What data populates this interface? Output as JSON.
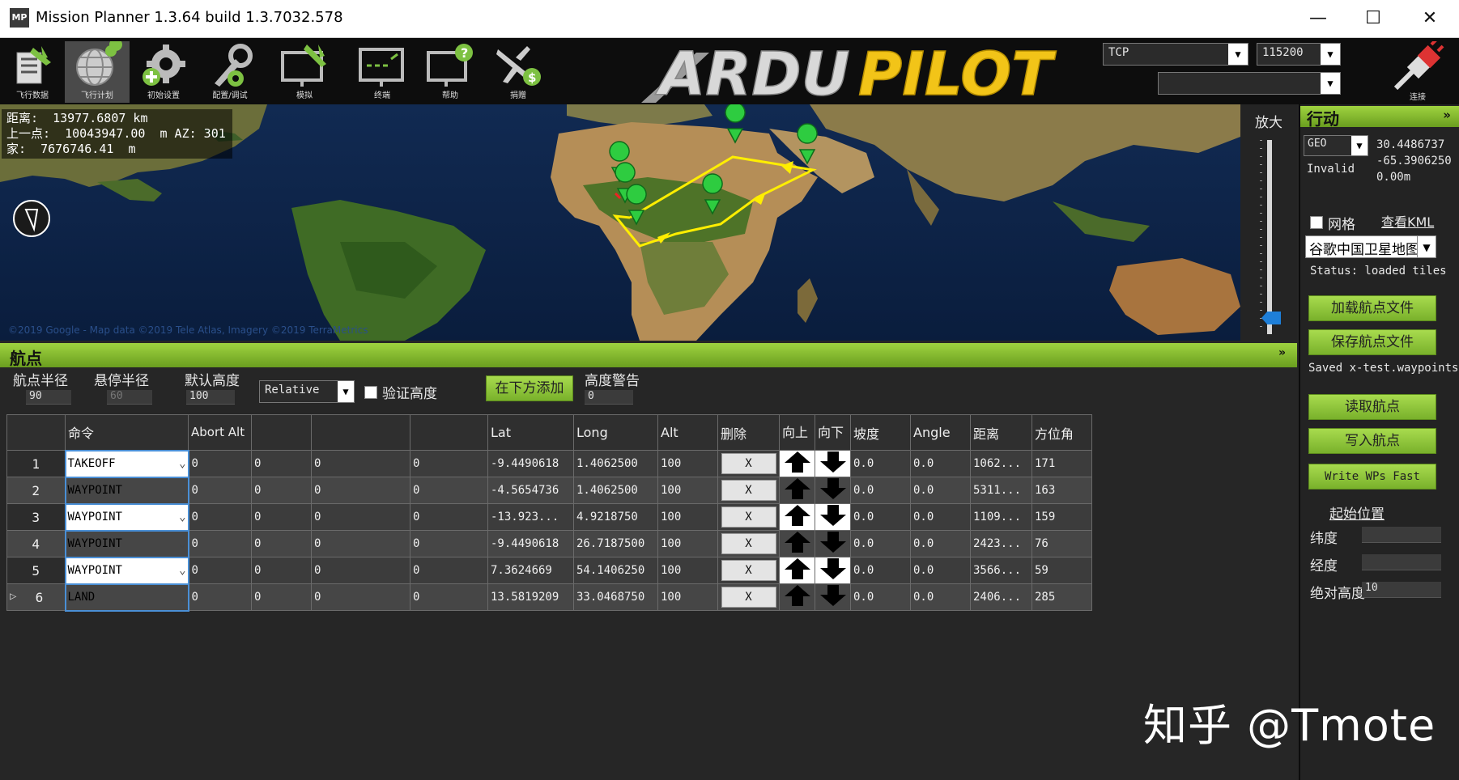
{
  "window": {
    "title": "Mission Planner 1.3.64 build 1.3.7032.578",
    "icon_text": "MP",
    "minimize": "—",
    "maximize": "☐",
    "close": "✕"
  },
  "toolbar": {
    "items": [
      {
        "label": "飞行数据",
        "icon": "flight-data-icon"
      },
      {
        "label": "飞行计划",
        "icon": "flight-plan-icon"
      },
      {
        "label": "初始设置",
        "icon": "initial-setup-icon"
      },
      {
        "label": "配置/调试",
        "icon": "config-tuning-icon"
      },
      {
        "label": "模拟",
        "icon": "simulation-icon"
      },
      {
        "label": "终端",
        "icon": "terminal-icon"
      },
      {
        "label": "帮助",
        "icon": "help-icon"
      },
      {
        "label": "捐赠",
        "icon": "donate-icon"
      }
    ],
    "logo_text_1": "ARDU",
    "logo_text_2": "PILOT",
    "connection_type": "TCP",
    "baud_rate": "115200",
    "port": "",
    "connect_label": "连接"
  },
  "map": {
    "info": {
      "distance": "距离:  13977.6807 km",
      "prev_point": "上一点:  10043947.00  m AZ: 301",
      "home": "家:  7676746.41  m"
    },
    "copyright": "©2019 Google - Map data ©2019 Tele Atlas, Imagery ©2019 TerraMetrics",
    "zoom_label": "放大"
  },
  "action_panel": {
    "title": "行动",
    "coord_system": "GEO",
    "lat": "30.4486737",
    "lng": "-65.3906250",
    "alt": "0.00m",
    "status_invalid": "Invalid",
    "grid_label": "网格",
    "view_kml": "查看KML",
    "map_provider": "谷歌中国卫星地图",
    "status": "Status: loaded tiles",
    "load_wp_file": "加载航点文件",
    "save_wp_file": "保存航点文件",
    "saved_msg": "Saved x-test.waypoints",
    "read_wp": "读取航点",
    "write_wp": "写入航点",
    "write_fast": "Write WPs Fast",
    "home_title": "起始位置",
    "home_lat_label": "纬度",
    "home_lng_label": "经度",
    "home_alt_label": "绝对高度",
    "home_lat": "",
    "home_lng": "",
    "home_alt": "10"
  },
  "waypoints": {
    "title": "航点",
    "wp_radius_label": "航点半径",
    "wp_radius": "90",
    "loiter_radius_label": "悬停半径",
    "loiter_radius": "60",
    "default_alt_label": "默认高度",
    "default_alt": "100",
    "alt_frame": "Relative",
    "verify_height": "验证高度",
    "add_below": "在下方添加",
    "alt_warn_label": "高度警告",
    "alt_warn": "0",
    "columns": [
      "",
      "命令",
      "Abort Alt",
      "",
      "",
      "",
      "Lat",
      "Long",
      "Alt",
      "删除",
      "向上",
      "向下",
      "坡度",
      "Angle",
      "距离",
      "方位角"
    ],
    "rows": [
      {
        "n": "1",
        "cmd": "TAKEOFF",
        "p1": "0",
        "p2": "0",
        "p3": "0",
        "p4": "0",
        "lat": "-9.4490618",
        "lng": "1.4062500",
        "alt": "100",
        "del": "X",
        "grad": "0.0",
        "angle": "0.0",
        "dist": "1062...",
        "az": "171",
        "current": ""
      },
      {
        "n": "2",
        "cmd": "WAYPOINT",
        "p1": "0",
        "p2": "0",
        "p3": "0",
        "p4": "0",
        "lat": "-4.5654736",
        "lng": "1.4062500",
        "alt": "100",
        "del": "X",
        "grad": "0.0",
        "angle": "0.0",
        "dist": "5311...",
        "az": "163",
        "current": ""
      },
      {
        "n": "3",
        "cmd": "WAYPOINT",
        "p1": "0",
        "p2": "0",
        "p3": "0",
        "p4": "0",
        "lat": "-13.923...",
        "lng": "4.9218750",
        "alt": "100",
        "del": "X",
        "grad": "0.0",
        "angle": "0.0",
        "dist": "1109...",
        "az": "159",
        "current": ""
      },
      {
        "n": "4",
        "cmd": "WAYPOINT",
        "p1": "0",
        "p2": "0",
        "p3": "0",
        "p4": "0",
        "lat": "-9.4490618",
        "lng": "26.7187500",
        "alt": "100",
        "del": "X",
        "grad": "0.0",
        "angle": "0.0",
        "dist": "2423...",
        "az": "76",
        "current": ""
      },
      {
        "n": "5",
        "cmd": "WAYPOINT",
        "p1": "0",
        "p2": "0",
        "p3": "0",
        "p4": "0",
        "lat": "7.3624669",
        "lng": "54.1406250",
        "alt": "100",
        "del": "X",
        "grad": "0.0",
        "angle": "0.0",
        "dist": "3566...",
        "az": "59",
        "current": ""
      },
      {
        "n": "6",
        "cmd": "LAND",
        "p1": "0",
        "p2": "0",
        "p3": "0",
        "p4": "0",
        "lat": "13.5819209",
        "lng": "33.0468750",
        "alt": "100",
        "del": "X",
        "grad": "0.0",
        "angle": "0.0",
        "dist": "2406...",
        "az": "285",
        "current": "▷"
      }
    ]
  },
  "watermark": "知乎 @Tmote",
  "colors": {
    "accent_green": "#8cc63f",
    "waypoint_marker": "#2ecc40",
    "route": "#ffee00"
  }
}
